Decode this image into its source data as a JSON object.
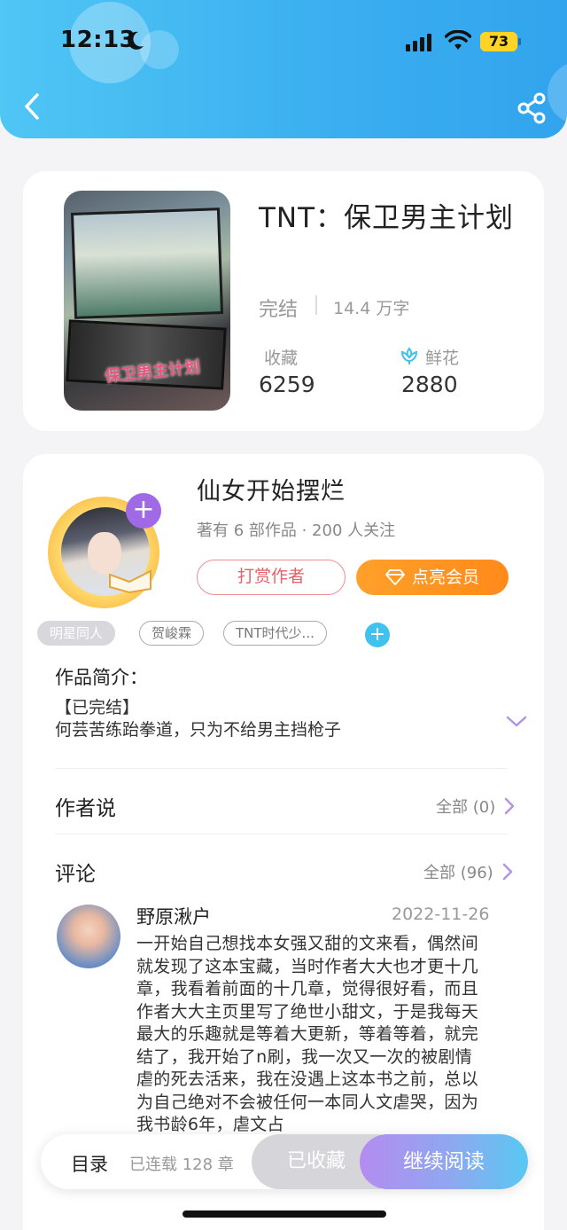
{
  "status_bar": {
    "time": "12:13",
    "battery": "73"
  },
  "book": {
    "title": "TNT：保卫男主计划",
    "cover_text": "保卫男主计划",
    "status": "完结",
    "word_count": "14.4 万字",
    "favorites_label": "收藏",
    "favorites_value": "6259",
    "flowers_label": "鲜花",
    "flowers_value": "2880"
  },
  "author": {
    "name": "仙女开始摆烂",
    "meta": "著有 6 部作品 · 200 人关注",
    "tip_button": "打赏作者",
    "vip_button": "点亮会员"
  },
  "tags": [
    "明星同人",
    "贺峻霖",
    "TNT时代少..."
  ],
  "intro": {
    "label": "作品简介：",
    "line1": "【已完结】",
    "line2": "何芸苦练跆拳道，只为不给男主挡枪子"
  },
  "author_says": {
    "title": "作者说",
    "more": "全部 (0)"
  },
  "comments": {
    "title": "评论",
    "more": "全部 (96)",
    "items": [
      {
        "user": "野原湫户",
        "date": "2022-11-26",
        "text": "一开始自己想找本女强又甜的文来看，偶然间就发现了这本宝藏，当时作者大大也才更十几章，我看着前面的十几章，觉得很好看，而且作者大大主页里写了绝世小甜文，于是我每天最大的乐趣就是等着大更新，等着等着，就完结了，我开始了n刷，我一次又一次的被剧情虐的死去活来，我在没遇上这本书之前，总以为自己绝对不会被任何一本同人文虐哭，因为我书龄6年，虐文占"
      }
    ]
  },
  "bottom_bar": {
    "toc": "目录",
    "serial": "已连载 128 章",
    "collected": "已收藏",
    "continue": "继续阅读"
  },
  "colors": {
    "header_blue": "#3aaef0",
    "accent_purple": "#a06ae6",
    "vip_orange": "#ff8a1a",
    "tip_red": "#ea5e6a"
  }
}
